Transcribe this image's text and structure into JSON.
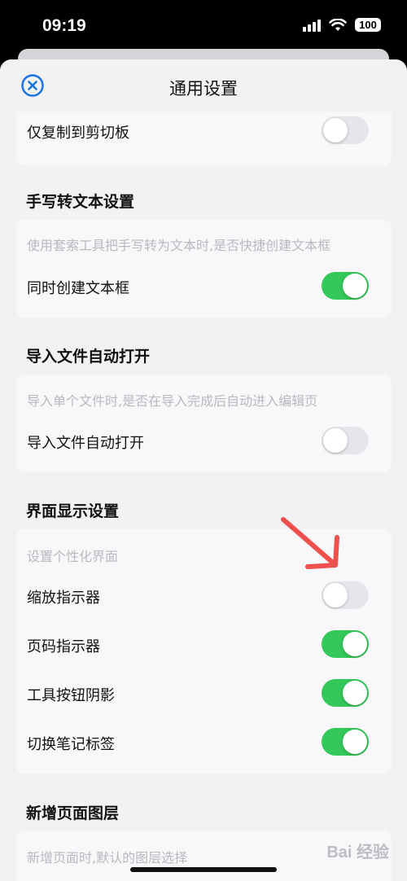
{
  "status": {
    "time": "09:19",
    "battery": "100"
  },
  "nav": {
    "title": "通用设置"
  },
  "rows": {
    "copy_clipboard": {
      "label": "仅复制到剪切板",
      "on": false
    },
    "handwriting_create_box": {
      "label": "同时创建文本框",
      "on": true
    },
    "import_auto_open": {
      "label": "导入文件自动打开",
      "on": false
    },
    "zoom_indicator": {
      "label": "缩放指示器",
      "on": false
    },
    "page_indicator": {
      "label": "页码指示器",
      "on": true
    },
    "tool_shadow": {
      "label": "工具按钮阴影",
      "on": true
    },
    "switch_note_tabs": {
      "label": "切换笔记标签",
      "on": true
    }
  },
  "sections": {
    "handwriting": {
      "title": "手写转文本设置",
      "hint": "使用套索工具把手写转为文本时,是否快捷创建文本框"
    },
    "import": {
      "title": "导入文件自动打开",
      "hint": "导入单个文件时,是否在导入完成后自动进入编辑页"
    },
    "display": {
      "title": "界面显示设置",
      "hint": "设置个性化界面"
    },
    "new_page": {
      "title": "新增页面图层",
      "hint": "新增页面时,默认的图层选择"
    }
  },
  "watermark": "Bai 经验",
  "colors": {
    "toggle_on": "#34c759",
    "toggle_off": "#e6e6ea",
    "accent": "#1a73e8",
    "annotation_arrow": "#f0504d"
  },
  "icons": {
    "close": "close-circle-icon",
    "annotation": "red-arrow-annotation"
  }
}
